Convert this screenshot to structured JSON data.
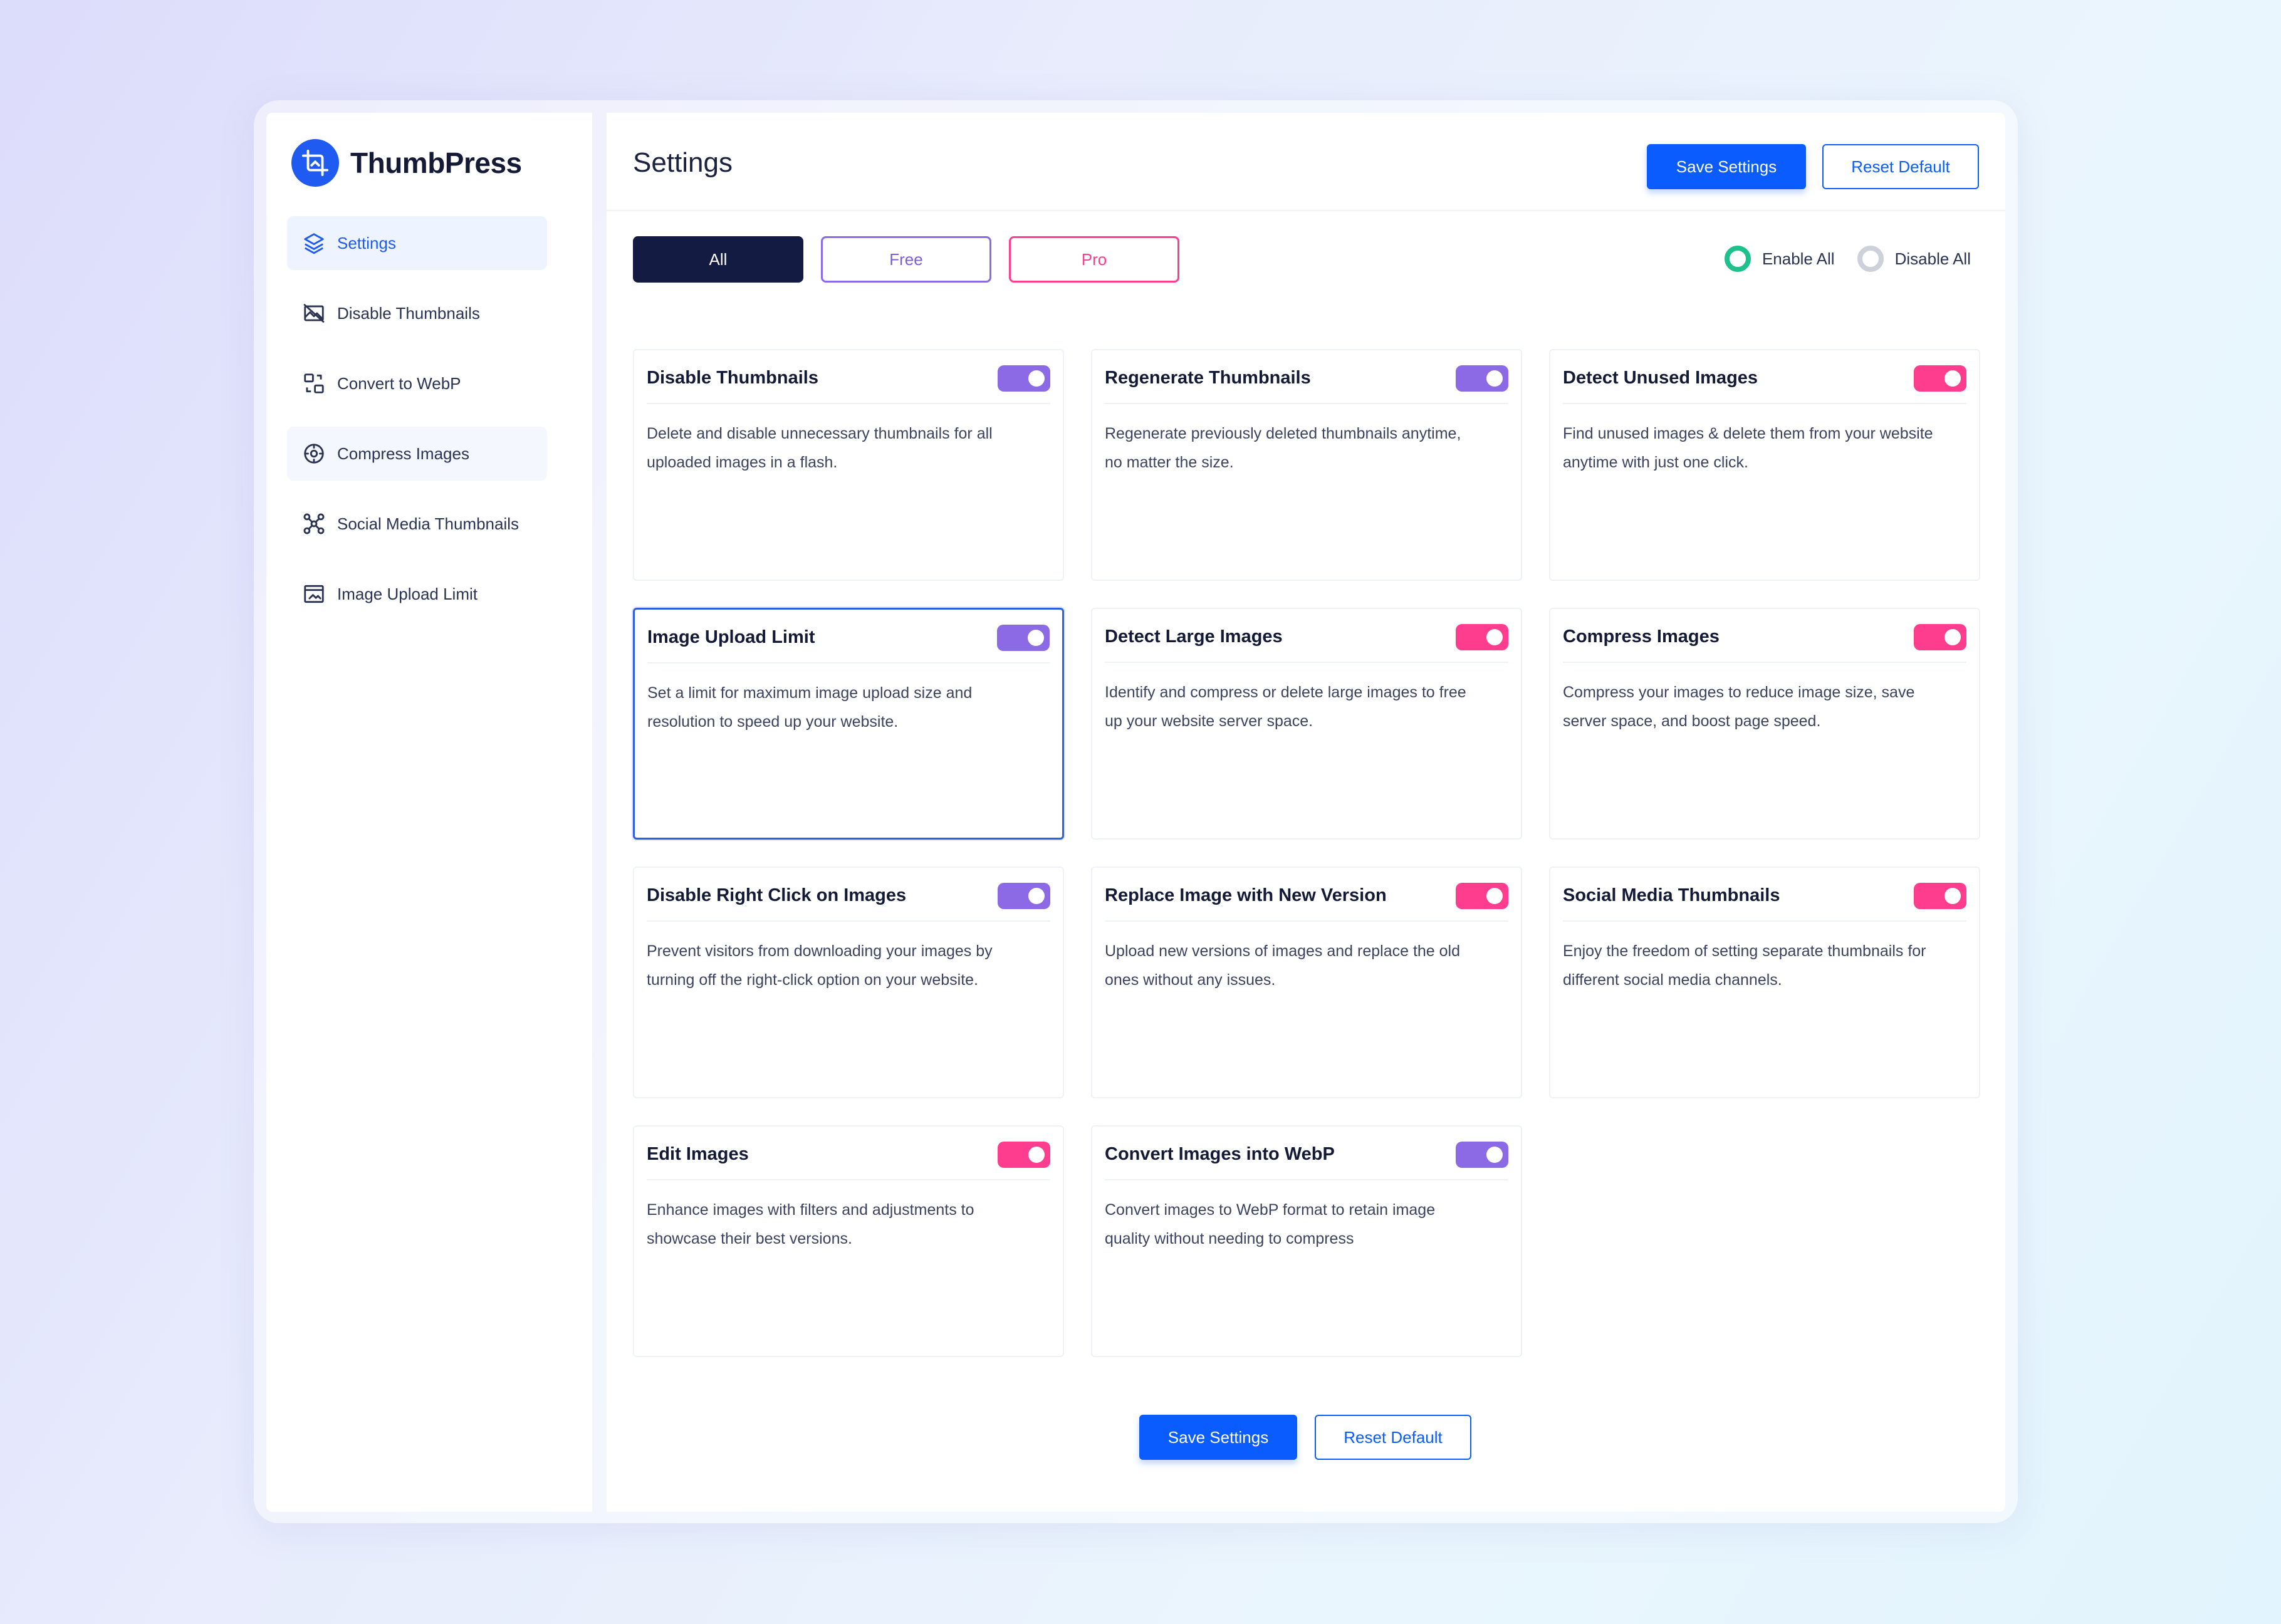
{
  "app": {
    "name": "ThumbPress"
  },
  "sidebar": {
    "items": [
      {
        "label": "Settings",
        "icon": "layers-icon"
      },
      {
        "label": "Disable Thumbnails",
        "icon": "image-off-icon"
      },
      {
        "label": "Convert to WebP",
        "icon": "convert-icon"
      },
      {
        "label": "Compress Images",
        "icon": "compress-icon"
      },
      {
        "label": "Social Media Thumbnails",
        "icon": "share-nodes-icon"
      },
      {
        "label": "Image Upload Limit",
        "icon": "upload-limit-icon"
      }
    ]
  },
  "header": {
    "title": "Settings",
    "save_label": "Save Settings",
    "reset_label": "Reset Default"
  },
  "filters": {
    "all": "All",
    "free": "Free",
    "pro": "Pro"
  },
  "bulk": {
    "enable_all": "Enable All",
    "disable_all": "Disable All"
  },
  "cards": [
    {
      "title": "Disable Thumbnails",
      "desc": "Delete and disable unnecessary thumbnails for all uploaded images in a flash.",
      "tier": "free"
    },
    {
      "title": "Regenerate Thumbnails",
      "desc": "Regenerate previously deleted thumbnails anytime, no matter the size.",
      "tier": "free"
    },
    {
      "title": "Detect Unused Images",
      "desc": "Find unused images & delete them from your website anytime with just one click.",
      "tier": "pro"
    },
    {
      "title": "Image Upload Limit",
      "desc": "Set a limit for maximum image upload size and resolution to speed up your website.",
      "tier": "free"
    },
    {
      "title": "Detect Large Images",
      "desc": "Identify and compress or delete large images to free up your website server space.",
      "tier": "pro"
    },
    {
      "title": "Compress Images",
      "desc": "Compress your images to reduce image size, save server space, and boost page speed.",
      "tier": "pro"
    },
    {
      "title": "Disable Right Click on Images",
      "desc": "Prevent visitors from downloading your images by turning off the right-click option on your website.",
      "tier": "free"
    },
    {
      "title": "Replace Image with New Version",
      "desc": "Upload new versions of images and replace the old ones without any issues.",
      "tier": "pro"
    },
    {
      "title": "Social Media Thumbnails",
      "desc": "Enjoy the freedom of setting separate thumbnails for different social media channels.",
      "tier": "pro"
    },
    {
      "title": "Edit Images",
      "desc": "Enhance images with filters and adjustments to showcase their best versions.",
      "tier": "pro"
    },
    {
      "title": "Convert Images into WebP",
      "desc": "Convert images to WebP format to retain image quality without needing to compress",
      "tier": "free"
    }
  ],
  "footer": {
    "save_label": "Save Settings",
    "reset_label": "Reset Default"
  },
  "colors": {
    "primary": "#0b5cff",
    "free_toggle": "#8c6ae5",
    "pro_toggle": "#ff3d8e",
    "enable_radio": "#1ec08c",
    "active_filter": "#141b43"
  }
}
